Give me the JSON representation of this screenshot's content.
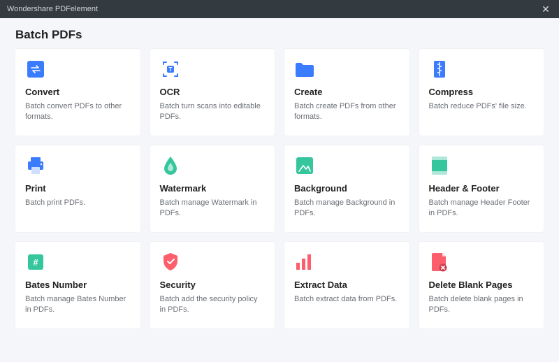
{
  "titlebar": {
    "app_name": "Wondershare PDFelement"
  },
  "page_title": "Batch PDFs",
  "cards": [
    {
      "title": "Convert",
      "desc": "Batch convert PDFs to other formats."
    },
    {
      "title": "OCR",
      "desc": "Batch turn scans into editable PDFs."
    },
    {
      "title": "Create",
      "desc": "Batch create PDFs from other formats."
    },
    {
      "title": "Compress",
      "desc": "Batch reduce PDFs' file size."
    },
    {
      "title": "Print",
      "desc": "Batch print PDFs."
    },
    {
      "title": "Watermark",
      "desc": "Batch manage Watermark in PDFs."
    },
    {
      "title": "Background",
      "desc": "Batch manage Background in PDFs."
    },
    {
      "title": "Header & Footer",
      "desc": "Batch manage Header  Footer in PDFs."
    },
    {
      "title": "Bates Number",
      "desc": "Batch manage Bates Number in PDFs."
    },
    {
      "title": "Security",
      "desc": "Batch add the security policy in PDFs."
    },
    {
      "title": "Extract Data",
      "desc": "Batch extract data from PDFs."
    },
    {
      "title": "Delete Blank Pages",
      "desc": "Batch delete blank pages in PDFs."
    }
  ]
}
